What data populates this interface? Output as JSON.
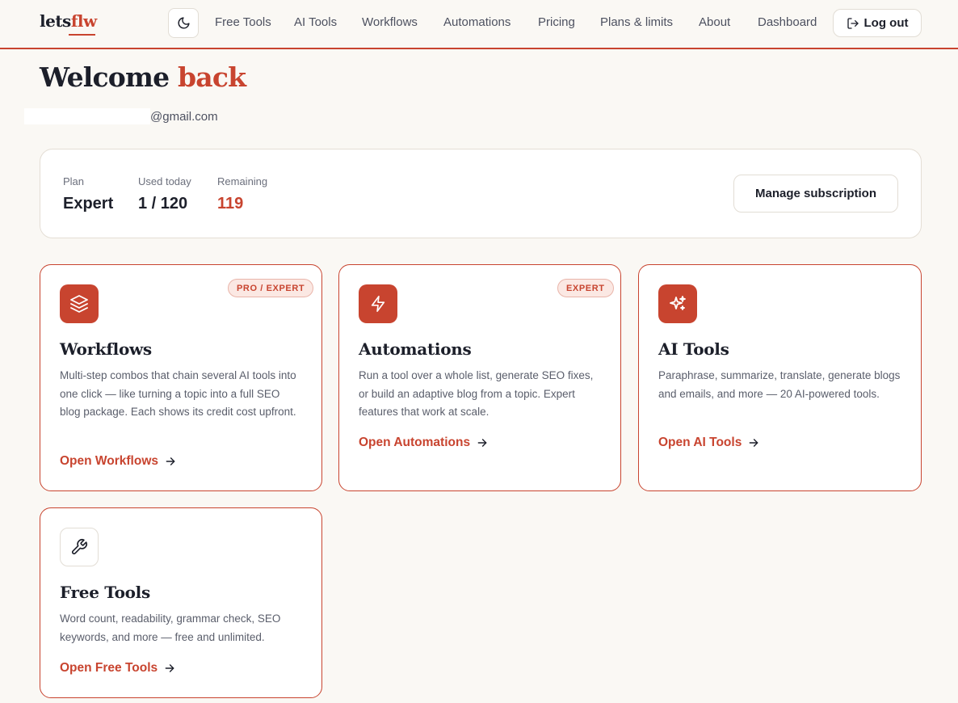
{
  "header": {
    "logo_prefix": "lets",
    "logo_accent": "flw",
    "nav": [
      "Free Tools",
      "AI Tools",
      "Workflows",
      "Automations",
      "Pricing",
      "Plans & limits",
      "About",
      "Dashboard"
    ],
    "logout_label": "Log out"
  },
  "welcome": {
    "title_main": "Welcome",
    "title_accent": "back",
    "email": "@gmail.com"
  },
  "plan": {
    "plan_label": "Plan",
    "plan_value": "Expert",
    "used_label": "Used today",
    "used_value": "1 / 120",
    "remaining_label": "Remaining",
    "remaining_value": "119",
    "manage_label": "Manage subscription"
  },
  "cards": [
    {
      "title": "Workflows",
      "badge": "PRO / EXPERT",
      "desc": "Multi-step combos that chain several AI tools into one click — like turning a topic into a full SEO blog package. Each shows its credit cost upfront.",
      "link": "Open Workflows",
      "icon": "layers-icon"
    },
    {
      "title": "Automations",
      "badge": "EXPERT",
      "desc": "Run a tool over a whole list, generate SEO fixes, or build an adaptive blog from a topic. Expert features that work at scale.",
      "link": "Open Automations",
      "icon": "bolt-icon"
    },
    {
      "title": "AI Tools",
      "desc": "Paraphrase, summarize, translate, generate blogs and emails, and more — 20 AI-powered tools.",
      "link": "Open AI Tools",
      "icon": "sparkles-icon"
    },
    {
      "title": "Free Tools",
      "desc": "Word count, readability, grammar check, SEO keywords, and more — free and unlimited.",
      "link": "Open Free Tools",
      "icon": "wrench-icon"
    }
  ],
  "colors": {
    "accent": "#c8442f",
    "background": "#faf8f4",
    "text": "#1c1f2a"
  }
}
